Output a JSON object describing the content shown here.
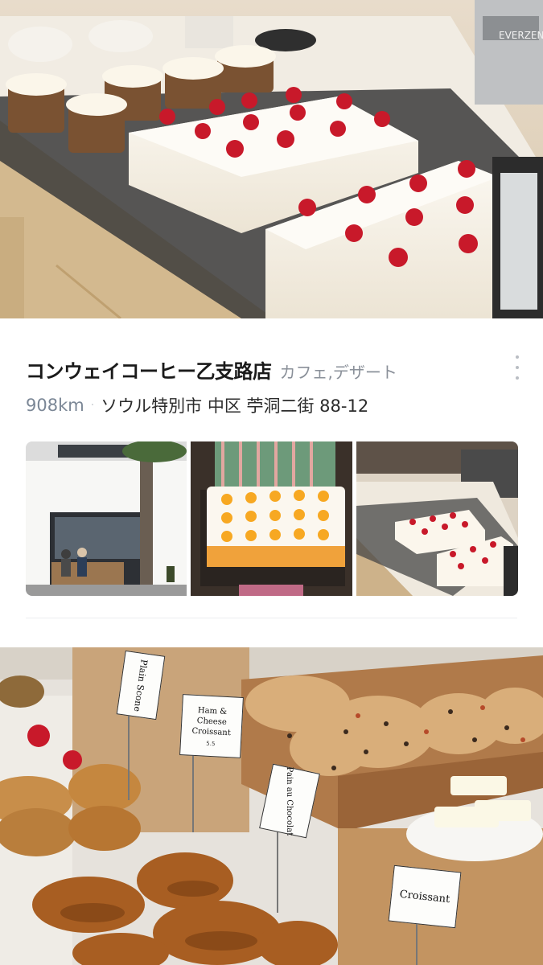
{
  "place": {
    "name": "コンウェイコーヒー乙支路店",
    "category": "カフェ,デザート",
    "distance": "908km",
    "separator": "·",
    "address": "ソウル特別市 中区 苧洞二街 88-12"
  },
  "hero_photo": {
    "brand_text": "EVERZEN"
  },
  "bakery_photo": {
    "labels": [
      {
        "title": "Plain Scone"
      },
      {
        "title": "Ham & Cheese Croissant",
        "price": "5.5"
      },
      {
        "title": "Pain au Chocolat"
      },
      {
        "title": "Croissant"
      }
    ]
  },
  "icons": {
    "more": "more-vertical-icon"
  },
  "colors": {
    "category": "#8a9099",
    "distance": "#7b8796",
    "title": "#1a1a1a"
  }
}
